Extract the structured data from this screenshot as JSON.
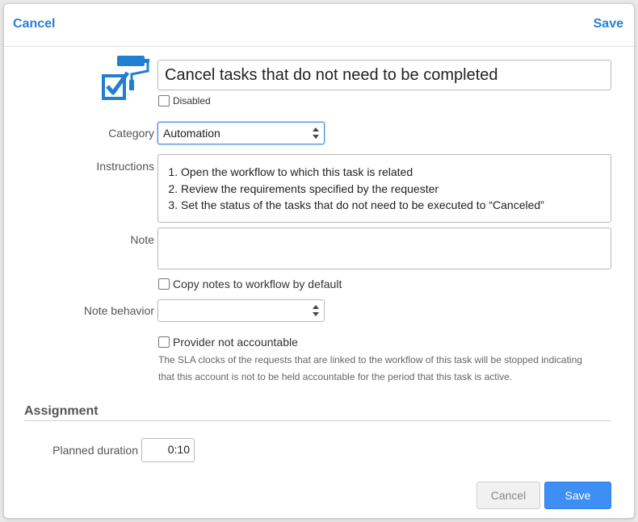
{
  "header": {
    "cancel_label": "Cancel",
    "save_label": "Save"
  },
  "task": {
    "icon": "paint-roller-checkbox-icon",
    "title": "Cancel tasks that do not need to be completed",
    "disabled_label": "Disabled",
    "disabled_checked": false
  },
  "category": {
    "label": "Category",
    "value": "Automation"
  },
  "instructions": {
    "label": "Instructions",
    "steps": [
      "Open the workflow to which this task is related",
      "Review the requirements specified by the requester",
      "Set the status of the tasks that do not need to be executed to “Canceled”"
    ]
  },
  "note": {
    "label": "Note",
    "value": "",
    "copy_label": "Copy notes to workflow by default",
    "copy_checked": false
  },
  "note_behavior": {
    "label": "Note behavior",
    "value": ""
  },
  "provider": {
    "label": "Provider not accountable",
    "checked": false,
    "hint_line1": "The SLA clocks of the requests that are linked to the workflow of this task will be stopped indicating",
    "hint_line2": "that this account is not to be held accountable for the period that this task is active."
  },
  "assignment": {
    "section_title": "Assignment",
    "planned_duration_label": "Planned duration",
    "planned_duration_value": "0:10"
  },
  "footer": {
    "cancel_label": "Cancel",
    "save_label": "Save"
  },
  "colors": {
    "accent": "#2a7fd4",
    "primary_button": "#3d8ff5",
    "icon": "#1f7fd1"
  }
}
